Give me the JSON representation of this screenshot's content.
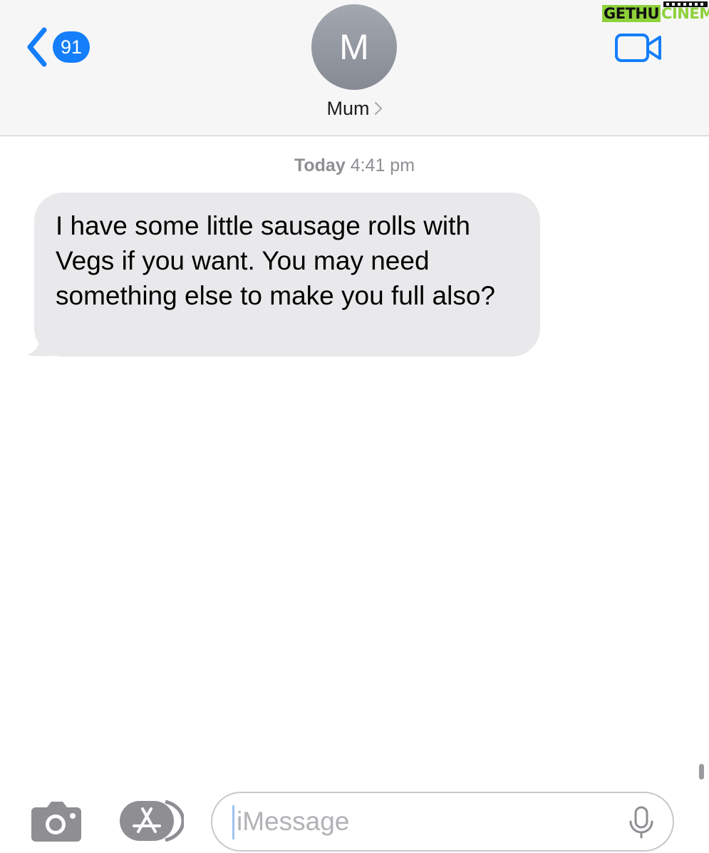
{
  "header": {
    "back_badge_count": "91",
    "avatar_initial": "M",
    "contact_name": "Mum",
    "watermark_left": "GETHU",
    "watermark_right": "CINEMA"
  },
  "conversation": {
    "timestamp_day": "Today",
    "timestamp_time": "4:41 pm",
    "messages": [
      {
        "direction": "incoming",
        "text": "I have some little sausage rolls with Vegs if you want. You may need something else to make you full also?"
      }
    ]
  },
  "input_bar": {
    "placeholder": "iMessage"
  },
  "colors": {
    "accent": "#147efb",
    "incoming_bubble": "#e9e9eb",
    "header_background": "#f6f6f7",
    "watermark_green": "#8ed13a"
  },
  "icons": [
    "back-chevron-icon",
    "video-camera-icon",
    "chevron-right-icon",
    "camera-icon",
    "app-store-icon",
    "microphone-icon",
    "film-strip-icon"
  ]
}
